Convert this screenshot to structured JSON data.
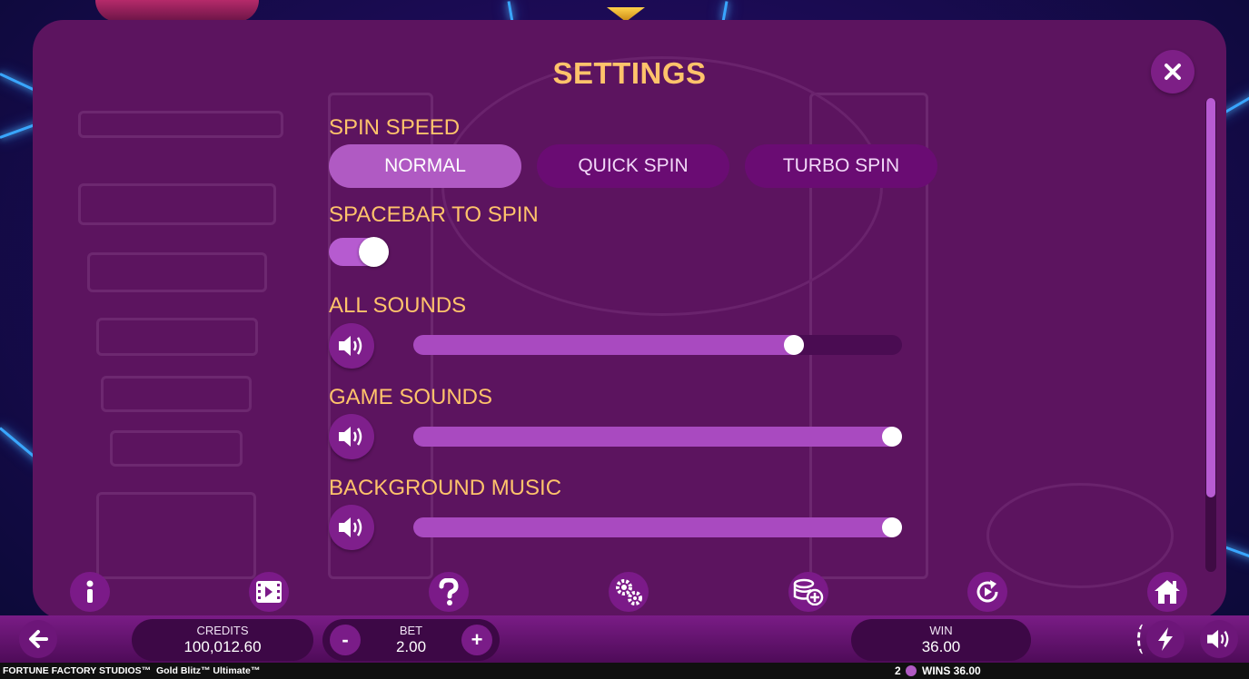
{
  "settings": {
    "title": "SETTINGS",
    "spin_speed": {
      "label": "SPIN SPEED",
      "options": [
        "NORMAL",
        "QUICK SPIN",
        "TURBO SPIN"
      ],
      "selected": "NORMAL"
    },
    "spacebar": {
      "label": "SPACEBAR TO SPIN",
      "enabled": true
    },
    "all_sounds": {
      "label": "ALL SOUNDS",
      "level": 0.79
    },
    "game_sounds": {
      "label": "GAME SOUNDS",
      "level": 1.0
    },
    "background_music": {
      "label": "BACKGROUND MUSIC",
      "level": 1.0
    }
  },
  "toolbar_icons": [
    "info-icon",
    "video-icon",
    "help-icon",
    "settings-gear-icon",
    "coins-add-icon",
    "replay-icon",
    "home-icon"
  ],
  "bottom_bar": {
    "credits_label": "CREDITS",
    "credits_value": "100,012.60",
    "bet_label": "BET",
    "bet_value": "2.00",
    "bet_minus": "-",
    "bet_plus": "+",
    "win_label": "WIN",
    "win_value": "36.00"
  },
  "footer": {
    "studio": "FORTUNE FACTORY STUDIOS™",
    "game": "Gold Blitz™ Ultimate™",
    "wins_count": "2",
    "wins_text": "WINS 36.00"
  },
  "colors": {
    "accent": "#ffc36b",
    "panel": "#5c145f",
    "slider_fill": "#a94ac0"
  }
}
